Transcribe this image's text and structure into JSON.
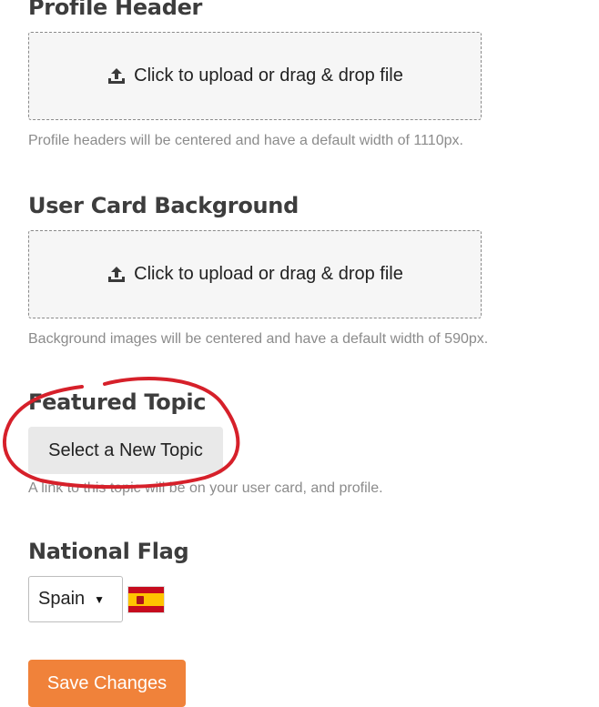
{
  "profile_header": {
    "title": "Profile Header",
    "upload_label": "Click to upload or drag & drop file",
    "help": "Profile headers will be centered and have a default width of 1110px."
  },
  "user_card_background": {
    "title": "User Card Background",
    "upload_label": "Click to upload or drag & drop file",
    "help": "Background images will be centered and have a default width of 590px."
  },
  "featured_topic": {
    "title": "Featured Topic",
    "button_label": "Select a New Topic",
    "help": "A link to this topic will be on your user card, and profile."
  },
  "national_flag": {
    "title": "National Flag",
    "selected": "Spain"
  },
  "save_button": {
    "label": "Save Changes"
  },
  "colors": {
    "accent": "#f0823a",
    "annotation": "#d6202a",
    "heading": "#3d3d3d",
    "help_text": "#8b8b8b"
  }
}
